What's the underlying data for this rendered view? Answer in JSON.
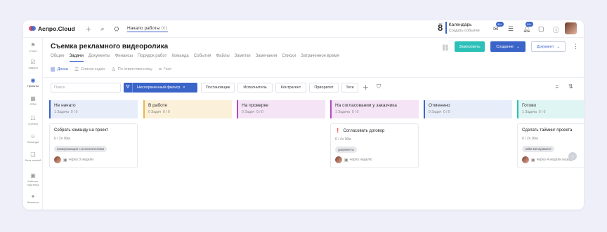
{
  "app": {
    "name": "Аспро.Cloud"
  },
  "topbar": {
    "start_work": "Начало работы",
    "start_work_count": "0/1",
    "calendar_weekday": "Вт",
    "calendar_day": "8",
    "calendar_title": "Календарь",
    "calendar_subtitle": "Создать событие",
    "badge_mail": "99+",
    "badge_notify": "99+"
  },
  "sidebar": {
    "items": [
      {
        "label": "Старт",
        "icon": "start-icon"
      },
      {
        "label": "Задачи",
        "icon": "tasks-icon"
      },
      {
        "label": "Проекты",
        "icon": "projects-icon",
        "active": true
      },
      {
        "label": "CRM",
        "icon": "crm-icon"
      },
      {
        "label": "Группы",
        "icon": "groups-icon"
      },
      {
        "label": "Команда",
        "icon": "team-icon"
      },
      {
        "label": "База знаний",
        "icon": "knowledge-icon"
      },
      {
        "label": "Кабинет партнера",
        "icon": "partner-icon"
      },
      {
        "label": "Финансы",
        "icon": "finance-icon"
      }
    ]
  },
  "project": {
    "title": "Съемка рекламного видеоролика",
    "tabs": [
      "Общее",
      "Задачи",
      "Документы",
      "Финансы",
      "Порядок работ",
      "Команда",
      "События",
      "Файлы",
      "Заметки",
      "Замечания",
      "Списки",
      "Затраченное время"
    ],
    "active_tab": "Задачи"
  },
  "actions": {
    "freeze": "Заморозить",
    "create": "Создание",
    "document": "Документ"
  },
  "views": [
    {
      "label": "Доска",
      "active": true
    },
    {
      "label": "Список задач"
    },
    {
      "label": "По ответственному"
    },
    {
      "label": "Гант"
    }
  ],
  "filters": {
    "search_placeholder": "Поиск",
    "unsaved": "Несохраненный фильтр",
    "buttons": [
      "Постановщик",
      "Исполнитель",
      "Контрагент",
      "Приоритет",
      "Теги"
    ]
  },
  "columns": [
    {
      "name": "Не начато",
      "count": "1 Задача",
      "time": "0 / 0",
      "color": "#3a64c8",
      "bg": "#e8edfa"
    },
    {
      "name": "В работе",
      "count": "0 Задач",
      "time": "0 / 0",
      "color": "#e8b84a",
      "bg": "#fbf0da"
    },
    {
      "name": "На проверке",
      "count": "0 Задач",
      "time": "0 / 0",
      "color": "#b04ac0",
      "bg": "#f4e4f6"
    },
    {
      "name": "На согласовании у заказчика",
      "count": "1 Задача",
      "time": "0 / 0",
      "color": "#b04ac0",
      "bg": "#f4e4f6"
    },
    {
      "name": "Отменено",
      "count": "0 Задач",
      "time": "0 / 0",
      "color": "#3a64c8",
      "bg": "#e8edfa"
    },
    {
      "name": "Готово",
      "count": "1 Задача",
      "time": "0 / 0",
      "color": "#2cc0b8",
      "bg": "#dff5f3"
    }
  ],
  "cards": [
    {
      "title": "Собрать команду на проект",
      "time": "0 / 2ч 00м",
      "tag": "коммуникация с исполнителями",
      "due": "через 3 недели",
      "urgent": false
    },
    {
      "title": "Согласовать договор",
      "time": "0 / 4ч 00м",
      "tag": "документы",
      "due": "через неделю",
      "urgent": true
    },
    {
      "title": "Сделать тайминг проекта",
      "time": "0 / 2ч 00м",
      "tag": "тайм-менеджмент",
      "due": "через 4 недели назад",
      "urgent": false
    }
  ]
}
